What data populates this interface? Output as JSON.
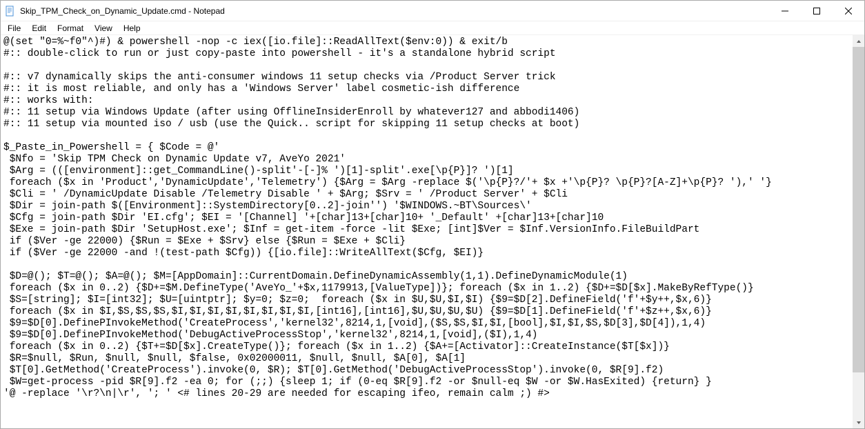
{
  "titlebar": {
    "title": "Skip_TPM_Check_on_Dynamic_Update.cmd - Notepad"
  },
  "menu": {
    "file": "File",
    "edit": "Edit",
    "format": "Format",
    "view": "View",
    "help": "Help"
  },
  "editor": {
    "content": "@(set \"0=%~f0\"^)#) & powershell -nop -c iex([io.file]::ReadAllText($env:0)) & exit/b\n#:: double-click to run or just copy-paste into powershell - it's a standalone hybrid script\n\n#:: v7 dynamically skips the anti-consumer windows 11 setup checks via /Product Server trick\n#:: it is most reliable, and only has a 'Windows Server' label cosmetic-ish difference\n#:: works with:\n#:: 11 setup via Windows Update (after using OfflineInsiderEnroll by whatever127 and abbodi1406)\n#:: 11 setup via mounted iso / usb (use the Quick.. script for skipping 11 setup checks at boot)\n\n$_Paste_in_Powershell = { $Code = @'\n $Nfo = 'Skip TPM Check on Dynamic Update v7, AveYo 2021'\n $Arg = (([environment]::get_CommandLine()-split'-[-]% ')[1]-split'.exe[\\p{P}]? ')[1]\n foreach ($x in 'Product','DynamicUpdate','Telemetry') {$Arg = $Arg -replace $('\\p{P}?/'+ $x +'\\p{P}? \\p{P}?[A-Z]+\\p{P}? '),' '}\n $Cli = ' /DynamicUpdate Disable /Telemetry Disable ' + $Arg; $Srv = ' /Product Server' + $Cli\n $Dir = join-path $([Environment]::SystemDirectory[0..2]-join'') '$WINDOWS.~BT\\Sources\\'\n $Cfg = join-path $Dir 'EI.cfg'; $EI = '[Channel] '+[char]13+[char]10+ '_Default' +[char]13+[char]10\n $Exe = join-path $Dir 'SetupHost.exe'; $Inf = get-item -force -lit $Exe; [int]$Ver = $Inf.VersionInfo.FileBuildPart\n if ($Ver -ge 22000) {$Run = $Exe + $Srv} else {$Run = $Exe + $Cli}\n if ($Ver -ge 22000 -and !(test-path $Cfg)) {[io.file]::WriteAllText($Cfg, $EI)}\n\n $D=@(); $T=@(); $A=@(); $M=[AppDomain]::CurrentDomain.DefineDynamicAssembly(1,1).DefineDynamicModule(1)\n foreach ($x in 0..2) {$D+=$M.DefineType('AveYo_'+$x,1179913,[ValueType])}; foreach ($x in 1..2) {$D+=$D[$x].MakeByRefType()}\n $S=[string]; $I=[int32]; $U=[uintptr]; $y=0; $z=0;  foreach ($x in $U,$U,$I,$I) {$9=$D[2].DefineField('f'+$y++,$x,6)}\n foreach ($x in $I,$S,$S,$S,$I,$I,$I,$I,$I,$I,$I,$I,[int16],[int16],$U,$U,$U,$U) {$9=$D[1].DefineField('f'+$z++,$x,6)}\n $9=$D[0].DefinePInvokeMethod('CreateProcess','kernel32',8214,1,[void],($S,$S,$I,$I,[bool],$I,$I,$S,$D[3],$D[4]),1,4)\n $9=$D[0].DefinePInvokeMethod('DebugActiveProcessStop','kernel32',8214,1,[void],($I),1,4)\n foreach ($x in 0..2) {$T+=$D[$x].CreateType()}; foreach ($x in 1..2) {$A+=[Activator]::CreateInstance($T[$x])}\n $R=$null, $Run, $null, $null, $false, 0x02000011, $null, $null, $A[0], $A[1]\n $T[0].GetMethod('CreateProcess').invoke(0, $R); $T[0].GetMethod('DebugActiveProcessStop').invoke(0, $R[9].f2)\n $W=get-process -pid $R[9].f2 -ea 0; for (;;) {sleep 1; if (0-eq $R[9].f2 -or $null-eq $W -or $W.HasExited) {return} }\n'@ -replace '\\r?\\n|\\r', '; ' <# lines 20-29 are needed for escaping ifeo, remain calm ;) #>"
  }
}
